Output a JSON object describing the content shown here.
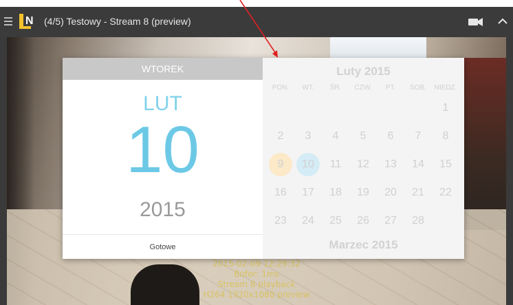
{
  "window": {
    "title": "(4/5) Testowy - Stream 8 (preview)",
    "icons": {
      "menu": "hamburger-icon",
      "logo": "app-logo",
      "camera": "video-camera-icon",
      "collapse": "chevron-up-icon"
    }
  },
  "overlay": {
    "lines": [
      "2015-02-09 12:29:32",
      "Bufor: 1ms",
      "Stream 8 playback",
      "H264 1920x1080 preview"
    ]
  },
  "date_picker": {
    "weekday": "WTOREK",
    "month_short": "LUT",
    "day": "10",
    "year": "2015",
    "done_label": "Gotowe",
    "month_title": "Luty 2015",
    "next_month_title": "Marzec 2015",
    "weekdays": [
      "PON.",
      "WT.",
      "ŚR.",
      "CZW.",
      "PT.",
      "SOB.",
      "NIEDZ."
    ],
    "weeks": [
      [
        "",
        "",
        "",
        "",
        "",
        "",
        "1"
      ],
      [
        "2",
        "3",
        "4",
        "5",
        "6",
        "7",
        "8"
      ],
      [
        "9",
        "10",
        "11",
        "12",
        "13",
        "14",
        "15"
      ],
      [
        "16",
        "17",
        "18",
        "19",
        "20",
        "21",
        "22"
      ],
      [
        "23",
        "24",
        "25",
        "26",
        "27",
        "28",
        ""
      ]
    ],
    "highlight": {
      "today": "9",
      "selected": "10",
      "today_color": "#fbe9c8",
      "selected_color": "#d4ecf5"
    }
  },
  "colors": {
    "accent": "#6cc9e6",
    "arrow": "#e02020",
    "overlay_text": "#d9c25a"
  }
}
